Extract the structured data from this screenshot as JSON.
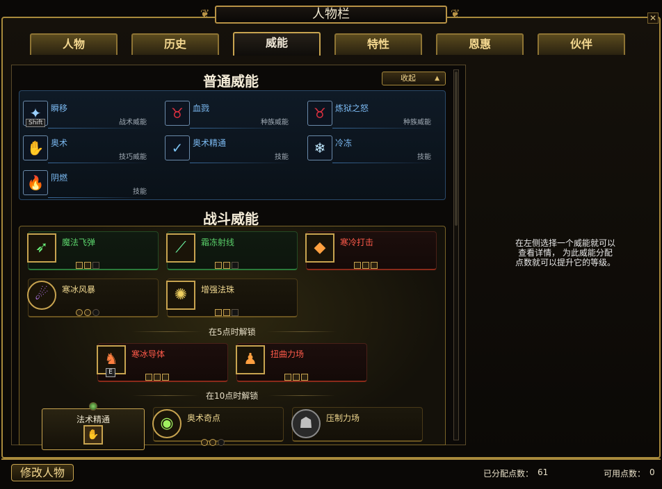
{
  "window": {
    "title": "人物栏",
    "close_glyph": "✕"
  },
  "tabs": [
    {
      "label": "人物"
    },
    {
      "label": "历史"
    },
    {
      "label": "威能",
      "active": true
    },
    {
      "label": "特性"
    },
    {
      "label": "恩惠"
    },
    {
      "label": "伙伴"
    }
  ],
  "normal_powers": {
    "title": "普通威能",
    "collapse_label": "收起",
    "items": [
      {
        "name": "瞬移",
        "type": "战术威能",
        "icon": "teleport-icon",
        "key": "Shift"
      },
      {
        "name": "血戮",
        "type": "种族威能",
        "icon": "tiefling-icon"
      },
      {
        "name": "炼狱之怒",
        "type": "种族威能",
        "icon": "tiefling-icon"
      },
      {
        "name": "奥术",
        "type": "技巧威能",
        "icon": "arcane-icon"
      },
      {
        "name": "奥术精通",
        "type": "技能",
        "icon": "arcane-mastery-icon"
      },
      {
        "name": "冷冻",
        "type": "技能",
        "icon": "snowflake-icon"
      },
      {
        "name": "阴燃",
        "type": "技能",
        "icon": "flame-icon"
      }
    ]
  },
  "combat_powers": {
    "title": "战斗威能",
    "items": [
      {
        "name": "魔法飞弹",
        "style": "green",
        "icon": "magic-missile-icon",
        "pips": [
          1,
          1,
          0
        ]
      },
      {
        "name": "霜冻射线",
        "style": "green",
        "icon": "ray-of-frost-icon",
        "pips": [
          1,
          1,
          0
        ]
      },
      {
        "name": "寒冷打击",
        "style": "red",
        "icon": "chilling-strike-icon",
        "pips": [
          1,
          1,
          1
        ]
      },
      {
        "name": "寒冰风暴",
        "style": "gold",
        "icon": "ice-storm-icon",
        "pips": [
          1,
          1,
          0
        ]
      },
      {
        "name": "增强法珠",
        "style": "gold",
        "icon": "orb-icon",
        "pips": [
          1,
          1,
          0
        ]
      },
      {
        "name": "寒冰导体",
        "style": "red",
        "icon": "conduit-icon",
        "pips": [
          1,
          1,
          1
        ],
        "key": "E"
      },
      {
        "name": "扭曲力场",
        "style": "red",
        "icon": "warping-field-icon",
        "pips": [
          1,
          1,
          1
        ]
      },
      {
        "name": "奥术奇点",
        "style": "gold",
        "icon": "singularity-icon",
        "pips": [
          1,
          1,
          0
        ]
      },
      {
        "name": "压制力场",
        "style": "gold",
        "icon": "repel-field-icon",
        "pips": []
      }
    ],
    "unlock_5": "在5点时解锁",
    "unlock_10": "在10点时解锁",
    "feat": {
      "label": "法术精通",
      "icon": "spell-mastery-icon"
    }
  },
  "hint_text": "在左侧选择一个威能就可以\n查看详情， 为此威能分配\n点数就可以提升它的等级。",
  "footer": {
    "modify_button": "修改人物",
    "assigned_label": "已分配点数：",
    "assigned_value": "61",
    "available_label": "可用点数：",
    "available_value": "0"
  }
}
